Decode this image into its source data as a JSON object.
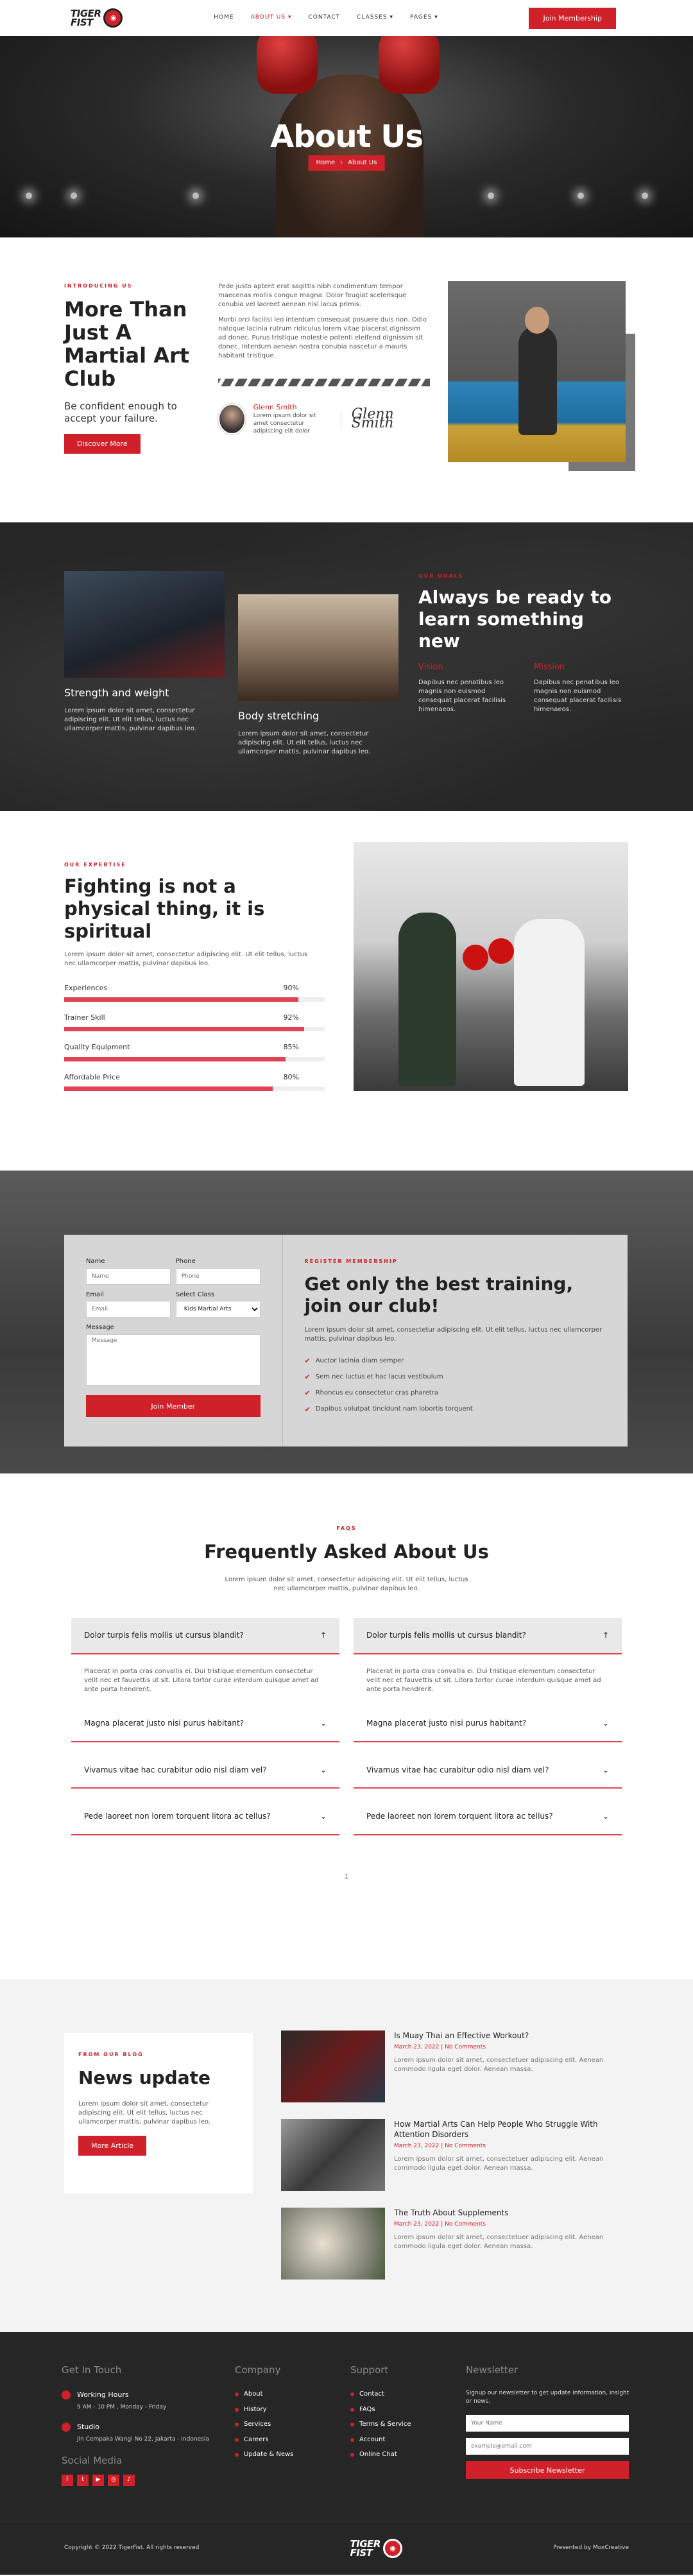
{
  "brand": {
    "line1": "TIGER",
    "line2": "FIST"
  },
  "nav": {
    "items": [
      {
        "label": "HOME"
      },
      {
        "label": "ABOUT US ▾"
      },
      {
        "label": "CONTACT"
      },
      {
        "label": "CLASSES ▾"
      },
      {
        "label": "PAGES ▾"
      }
    ],
    "cta": "Join Membership"
  },
  "hero": {
    "title": "About Us",
    "crumb_home": "Home",
    "crumb_sep": "›",
    "crumb_current": "About Us"
  },
  "intro": {
    "eyebrow": "INTRODUCING US",
    "title": "More Than Just A Martial Art Club",
    "tagline": "Be confident enough to accept your failure.",
    "button": "Discover More",
    "para1": "Pede justo aptent erat sagittis nibh condimentum tempor maecenas mollis congue magna. Dolor feugiat scelerisque conubia vel laoreet aenean nisl lacus primis.",
    "para2": "Morbi orci facilisi leo interdum consequat posuere duis non. Odio natoque lacinia rutrum ridiculus lorem vitae placerat dignissim ad donec. Purus tristique molestie potenti eleifend dignissim sit donec. Interdum aenean nostra conubia nascetur a mauris habitant tristique.",
    "author_name": "Glenn Smith",
    "author_bio": "Lorem ipsum dolor sit amet consectetur adipiscing elit dolor",
    "signature": "Glenn Smith"
  },
  "services": {
    "card1": {
      "title": "Strength and weight",
      "text": "Lorem ipsum dolor sit amet, consectetur adipiscing elit. Ut elit tellus, luctus nec ullamcorper mattis, pulvinar dapibus leo."
    },
    "card2": {
      "title": "Body stretching",
      "text": "Lorem ipsum dolor sit amet, consectetur adipiscing elit. Ut elit tellus, luctus nec ullamcorper mattis, pulvinar dapibus leo."
    },
    "eyebrow": "OUR GOALS",
    "title": "Always be ready to learn something new",
    "vision_title": "Vision",
    "vision_text": "Dapibus nec penatibus leo magnis non euismod consequat placerat facilisis himenaeos.",
    "mission_title": "Mission",
    "mission_text": "Dapibus nec penatibus leo magnis non euismod consequat placerat facilisis himenaeos."
  },
  "skills": {
    "eyebrow": "OUR EXPERTISE",
    "title": "Fighting is not a physical thing, it is spiritual",
    "lead": "Lorem ipsum dolor sit amet, consectetur adipiscing elit. Ut elit tellus, luctus nec ullamcorper mattis, pulvinar dapibus leo.",
    "bars": [
      {
        "label": "Experiences",
        "value": 90,
        "text": "90%"
      },
      {
        "label": "Trainer Skill",
        "value": 92,
        "text": "92%"
      },
      {
        "label": "Quality Equipment",
        "value": 85,
        "text": "85%"
      },
      {
        "label": "Affordable Price",
        "value": 80,
        "text": "80%"
      }
    ]
  },
  "form": {
    "name_label": "Name",
    "name_ph": "Name",
    "phone_label": "Phone",
    "phone_ph": "Phone",
    "email_label": "Email",
    "email_ph": "Email",
    "class_label": "Select Class",
    "class_value": "Kids Martial Arts",
    "message_label": "Message",
    "message_ph": "Message",
    "submit": "Join Member",
    "eyebrow": "REGISTER MEMBERSHIP",
    "title": "Get only the best training, join our club!",
    "text": "Lorem ipsum dolor sit amet, consectetur adipiscing elit. Ut elit tellus, luctus nec ullamcorper mattis, pulvinar dapibus leo.",
    "list": [
      "Auctor lacinia diam semper",
      "Sem nec luctus et hac lacus vestibulum",
      "Rhoncus eu consectetur cras pharetra",
      "Dapibus volutpat tincidunt nam lobortis torquent"
    ]
  },
  "faq": {
    "eyebrow": "FAQS",
    "title": "Frequently Asked About Us",
    "lead": "Lorem ipsum dolor sit amet, consectetur adipiscing elit. Ut elit tellus, luctus nec ullamcorper mattis, pulvinar dapibus leo.",
    "left": [
      {
        "q": "Dolor turpis felis mollis ut cursus blandit?",
        "a": "Placerat in porta cras convallis ei. Dui tristique elementum consectetur velit nec et fauvettis ut sit. Litora tortor curae interdum quisque amet ad ante porta hendrerit."
      },
      {
        "q": "Magna placerat justo nisi purus habitant?"
      },
      {
        "q": "Vivamus vitae hac curabitur odio nisl diam vel?"
      },
      {
        "q": "Pede laoreet non lorem torquent litora ac tellus?"
      }
    ],
    "right": [
      {
        "q": "Dolor turpis felis mollis ut cursus blandit?",
        "a": "Placerat in porta cras convallis ei. Dui tristique elementum consectetur velit nec et fauvettis ut sit. Litora tortor curae interdum quisque amet ad ante porta hendrerit."
      },
      {
        "q": "Magna placerat justo nisi purus habitant?"
      },
      {
        "q": "Vivamus vitae hac curabitur odio nisl diam vel?"
      },
      {
        "q": "Pede laoreet non lorem torquent litora ac tellus?"
      }
    ],
    "page": "1"
  },
  "blog": {
    "eyebrow": "FROM OUR BLOG",
    "title": "News update",
    "text": "Lorem ipsum dolor sit amet, consectetur adipiscing elit. Ut elit tellus, luctus nec ullamcorper mattis, pulvinar dapibus leo.",
    "button": "More Article",
    "posts": [
      {
        "title": "Is Muay Thai an Effective Workout?",
        "meta": "March 23, 2022 | No Comments",
        "text": "Lorem ipsum dolor sit amet, consectetuer adipiscing elit. Aenean commodo ligula eget dolor. Aenean massa."
      },
      {
        "title": "How Martial Arts Can Help People Who Struggle With Attention Disorders",
        "meta": "March 23, 2022 | No Comments",
        "text": "Lorem ipsum dolor sit amet, consectetuer adipiscing elit. Aenean commodo ligula eget dolor. Aenean massa."
      },
      {
        "title": "The Truth About Supplements",
        "meta": "March 23, 2022 | No Comments",
        "text": "Lorem ipsum dolor sit amet, consectetuer adipiscing elit. Aenean commodo ligula eget dolor. Aenean massa."
      }
    ]
  },
  "footer": {
    "touch_title": "Get In Touch",
    "hours_title": "Working Hours",
    "hours": "9 AM - 10 PM , Monday - Friday",
    "studio_title": "Studio",
    "studio": "Jln Cempaka Wangi No 22, Jakarta - Indonesia",
    "social_title": "Social Media",
    "social": [
      "f",
      "t",
      "▶",
      "◎",
      "♪"
    ],
    "company_title": "Company",
    "company": [
      "About",
      "History",
      "Services",
      "Careers",
      "Update & News"
    ],
    "support_title": "Support",
    "support": [
      "Contact",
      "FAQs",
      "Terms & Service",
      "Account",
      "Online Chat"
    ],
    "news_title": "Newsletter",
    "news_text": "Signup our newsletter to get update information, insight or news.",
    "news_name": "Your Name",
    "news_email": "example@email.com",
    "news_button": "Subscribe Newsletter",
    "copyright": "Copyright © 2022 TigerFist. All rights reserved",
    "credit": "Presented by MoxCreative"
  },
  "colors": {
    "accent": "#d0202a",
    "dark": "#262626",
    "bar": "#e04452"
  }
}
